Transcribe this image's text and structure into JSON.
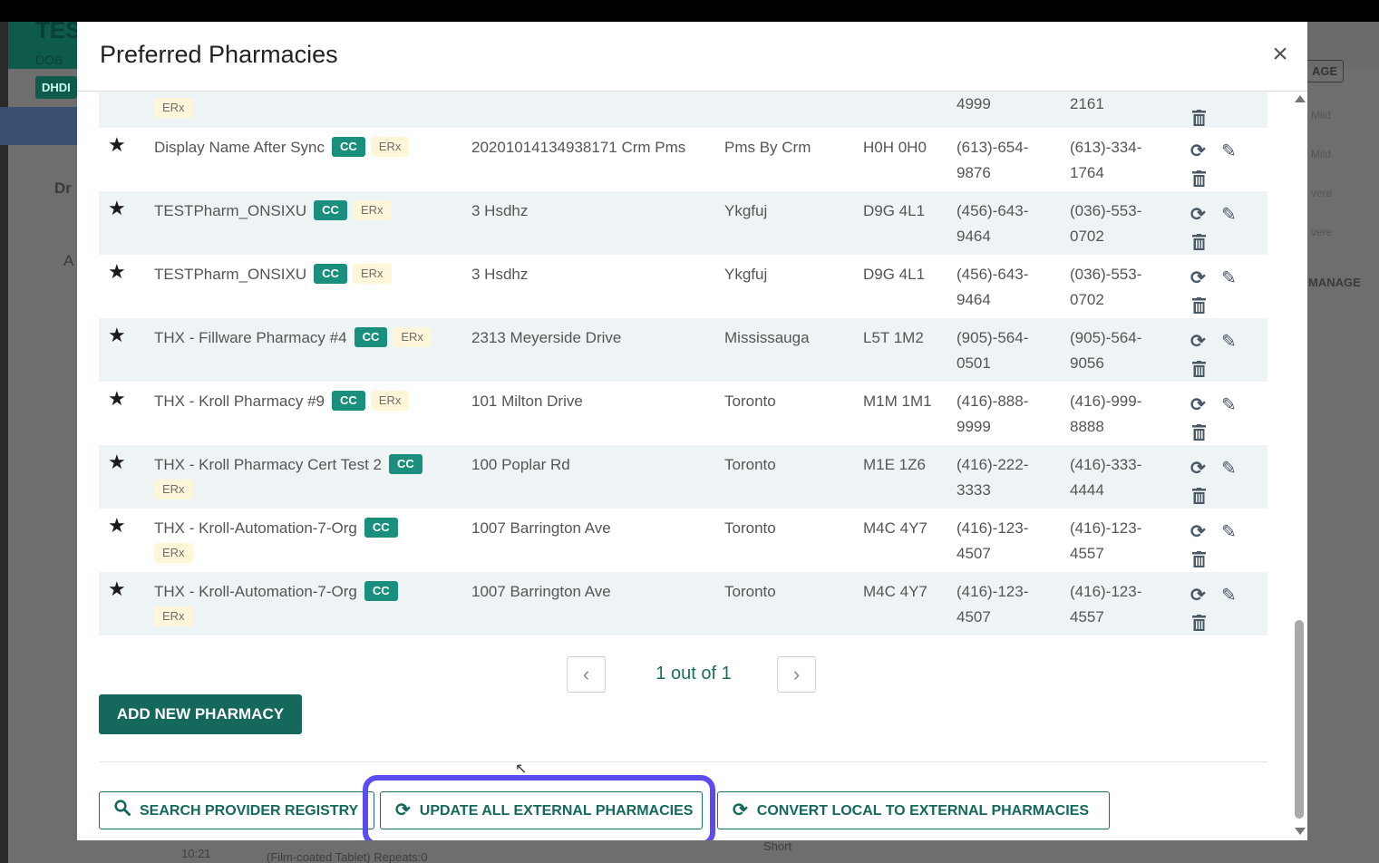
{
  "background": {
    "title_fragment": "TES",
    "dob_fragment": "DOB",
    "tag_fragment": "DHDI",
    "side_fragment": "Dr",
    "side_fragment2": "A",
    "right_button": "AGE",
    "right_manage": "MANAGE",
    "badges": [
      "Mild",
      "Mild",
      "vere",
      "vere"
    ],
    "footer_text": "(Film-coated Tablet) Repeats:0",
    "footer_text2": "Short",
    "footer_time": "10:21"
  },
  "modal": {
    "title": "Preferred Pharmacies",
    "close_label": "×",
    "colors": {
      "primary": "#14695c",
      "badge_cc": "#1a8f7d",
      "badge_erx_bg": "#fdf6d8",
      "highlight": "#5a4cf0"
    },
    "first_row_partial": {
      "erx": "ERx",
      "phone": "4999",
      "fax": "2161"
    },
    "rows": [
      {
        "name": "Display Name After Sync",
        "cc": "CC",
        "erx": "ERx",
        "erx_newline": false,
        "address": "20201014134938171 Crm Pms",
        "city": "Pms By Crm",
        "postal": "H0H 0H0",
        "phone1": "(613)-654-",
        "phone2": "9876",
        "fax1": "(613)-334-",
        "fax2": "1764"
      },
      {
        "name": "TESTPharm_ONSIXU",
        "cc": "CC",
        "erx": "ERx",
        "erx_newline": false,
        "address": "3 Hsdhz",
        "city": "Ykgfuj",
        "postal": "D9G 4L1",
        "phone1": "(456)-643-",
        "phone2": "9464",
        "fax1": "(036)-553-",
        "fax2": "0702"
      },
      {
        "name": "TESTPharm_ONSIXU",
        "cc": "CC",
        "erx": "ERx",
        "erx_newline": false,
        "address": "3 Hsdhz",
        "city": "Ykgfuj",
        "postal": "D9G 4L1",
        "phone1": "(456)-643-",
        "phone2": "9464",
        "fax1": "(036)-553-",
        "fax2": "0702"
      },
      {
        "name": "THX - Fillware Pharmacy #4",
        "cc": "CC",
        "erx": "ERx",
        "erx_newline": false,
        "address": "2313 Meyerside Drive",
        "city": "Mississauga",
        "postal": "L5T 1M2",
        "phone1": "(905)-564-",
        "phone2": "0501",
        "fax1": "(905)-564-",
        "fax2": "9056"
      },
      {
        "name": "THX - Kroll Pharmacy #9",
        "cc": "CC",
        "erx": "ERx",
        "erx_newline": false,
        "address": "101 Milton Drive",
        "city": "Toronto",
        "postal": "M1M 1M1",
        "phone1": "(416)-888-",
        "phone2": "9999",
        "fax1": "(416)-999-",
        "fax2": "8888"
      },
      {
        "name": "THX - Kroll Pharmacy Cert Test 2",
        "cc": "CC",
        "erx": "ERx",
        "erx_newline": true,
        "address": "100 Poplar Rd",
        "city": "Toronto",
        "postal": "M1E 1Z6",
        "phone1": "(416)-222-",
        "phone2": "3333",
        "fax1": "(416)-333-",
        "fax2": "4444"
      },
      {
        "name": "THX - Kroll-Automation-7-Org",
        "cc": "CC",
        "erx": "ERx",
        "erx_newline": true,
        "address": "1007 Barrington Ave",
        "city": "Toronto",
        "postal": "M4C 4Y7",
        "phone1": "(416)-123-",
        "phone2": "4507",
        "fax1": "(416)-123-",
        "fax2": "4557"
      },
      {
        "name": "THX - Kroll-Automation-7-Org",
        "cc": "CC",
        "erx": "ERx",
        "erx_newline": true,
        "address": "1007 Barrington Ave",
        "city": "Toronto",
        "postal": "M4C 4Y7",
        "phone1": "(416)-123-",
        "phone2": "4507",
        "fax1": "(416)-123-",
        "fax2": "4557"
      }
    ],
    "pagination": {
      "prev": "‹",
      "next": "›",
      "info": "1 out of 1"
    },
    "add_button": "ADD NEW PHARMACY",
    "footer_buttons": {
      "search": "SEARCH PROVIDER REGISTRY",
      "update": "UPDATE ALL EXTERNAL PHARMACIES",
      "convert": "CONVERT LOCAL TO EXTERNAL PHARMACIES"
    },
    "icons": {
      "star": "star-icon",
      "refresh": "refresh-icon",
      "edit": "pencil-icon",
      "trash": "trash-icon",
      "search": "search-icon",
      "close": "close-icon"
    }
  }
}
